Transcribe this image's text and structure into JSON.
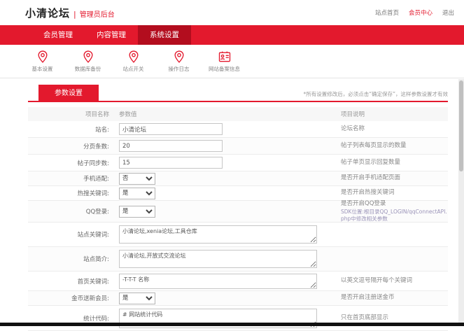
{
  "colors": {
    "brand_red": "#e3192d",
    "nav_active_red": "#b30d1e",
    "footer_bar": "#111111"
  },
  "header": {
    "logo": "小清论坛",
    "logo_separator": "|",
    "logo_sub": "管理员后台",
    "links": [
      {
        "label": "站点首页"
      },
      {
        "label": "会员中心"
      },
      {
        "label": "退出"
      }
    ]
  },
  "nav": {
    "tabs": [
      {
        "label": "会员管理",
        "active": false
      },
      {
        "label": "内容管理",
        "active": false
      },
      {
        "label": "系统设置",
        "active": true
      }
    ]
  },
  "toolbar": {
    "items": [
      {
        "label": "基本设置",
        "icon": "map-pin-icon"
      },
      {
        "label": "数据库备份",
        "icon": "map-pin-icon"
      },
      {
        "label": "站点开关",
        "icon": "map-pin-icon"
      },
      {
        "label": "操作日志",
        "icon": "map-pin-icon"
      },
      {
        "label": "网站备案信息",
        "icon": "id-card-icon"
      }
    ]
  },
  "content": {
    "tab_label": "参数设置",
    "hint": "*所有设置修改后，必须点击“确定保存”，这样参数设置才有效"
  },
  "table_header": {
    "name": "项目名称",
    "value": "参数值",
    "desc": "项目说明"
  },
  "form": {
    "rows": [
      {
        "label": "站名:",
        "type": "input",
        "value": "小清论坛",
        "desc": "论坛名称"
      },
      {
        "label": "分页条数:",
        "type": "input",
        "value": "20",
        "desc": "帖子列表每页显示的数量"
      },
      {
        "label": "帖子同步数:",
        "type": "input",
        "value": "15",
        "desc": "帖子单页显示回复数量"
      },
      {
        "label": "手机适配:",
        "type": "select",
        "value": "否",
        "desc": "是否开启手机适配页面"
      },
      {
        "label": "热搜关键词:",
        "type": "select",
        "value": "是",
        "desc": "是否开启热搜关键词"
      },
      {
        "label": "QQ登录:",
        "type": "select",
        "value": "是",
        "desc": "是否开启QQ登录",
        "desc2": "SDK位置:根目录QQ_LOGIN/qqConnectAPI.php中修改相关参数"
      },
      {
        "label": "站点关键词:",
        "type": "textarea",
        "value": "小清论坛,xenia论坛,工具仓库",
        "desc": ""
      },
      {
        "label": "站点简介:",
        "type": "textarea",
        "value": "小清论坛,开放式交流论坛",
        "desc": ""
      },
      {
        "label": "首页关键词:",
        "type": "textarea",
        "value": "-T-T-T 名称",
        "desc": "以英文逗号隔开每个关键词"
      },
      {
        "label": "金币送新会员:",
        "type": "select",
        "value": "是",
        "desc": "是否开启注册送金币"
      },
      {
        "label": "统计代码:",
        "type": "textarea",
        "value": "# 网站统计代码",
        "desc": "只在首页底部显示"
      }
    ]
  }
}
